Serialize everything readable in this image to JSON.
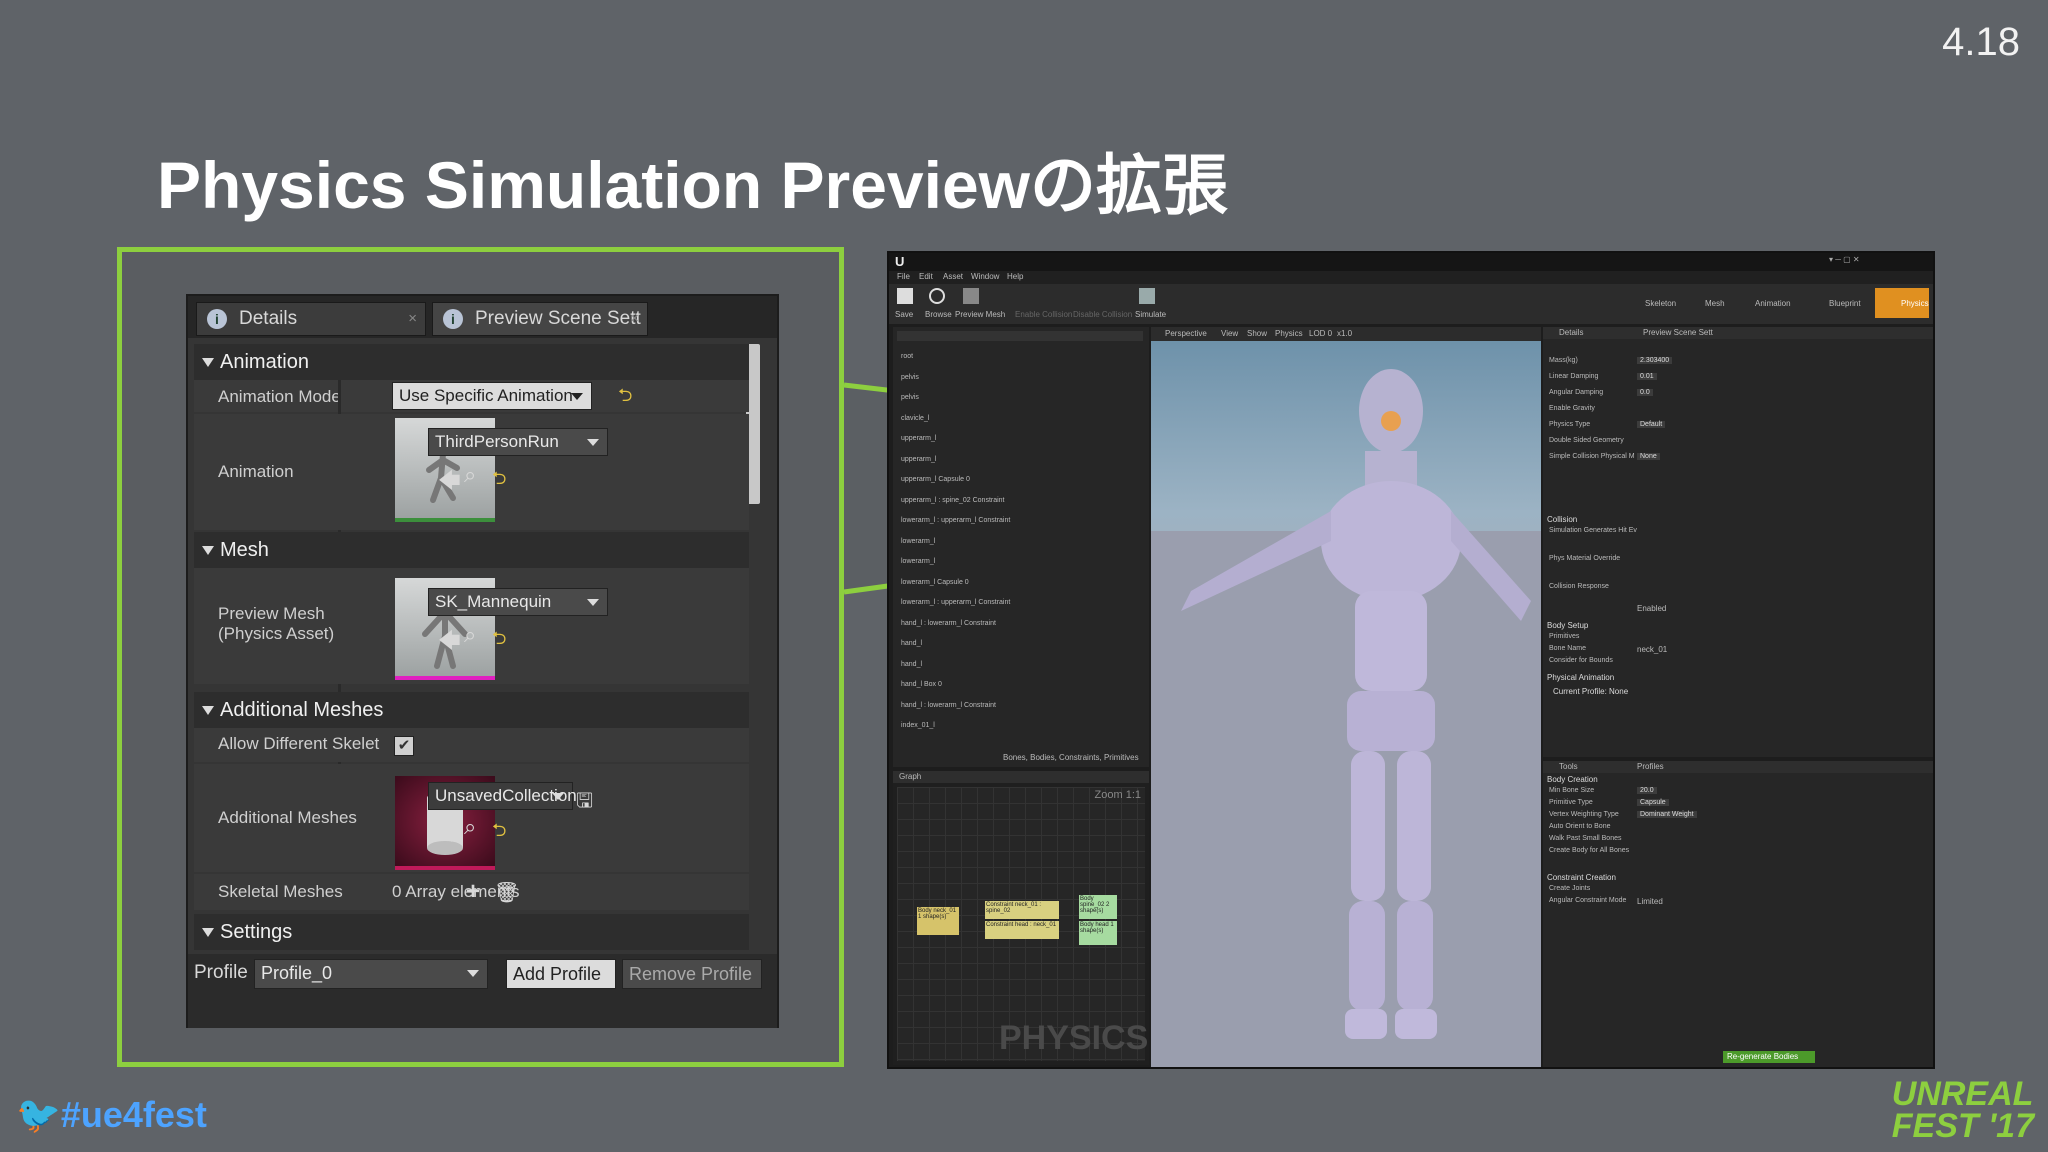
{
  "slide": {
    "version": "4.18",
    "title": "Physics Simulation Previewの拡張",
    "hashtag": "#ue4fest",
    "event_logo_line1": "UNREAL",
    "event_logo_line2": "FEST '17"
  },
  "details_panel": {
    "tabs": [
      {
        "label": "Details"
      },
      {
        "label": "Preview Scene Sett"
      }
    ],
    "sections": {
      "animation": {
        "header": "Animation",
        "animation_mode_label": "Animation Mode",
        "animation_mode_value": "Use Specific Animation",
        "animation_label": "Animation",
        "animation_value": "ThirdPersonRun"
      },
      "mesh": {
        "header": "Mesh",
        "preview_mesh_label_1": "Preview Mesh",
        "preview_mesh_label_2": "(Physics Asset)",
        "preview_mesh_value": "SK_Mannequin"
      },
      "additional_meshes": {
        "header": "Additional Meshes",
        "allow_different_label": "Allow Different Skelet",
        "allow_different_checked": true,
        "additional_meshes_label": "Additional Meshes",
        "additional_meshes_value": "UnsavedCollection",
        "skeletal_meshes_label": "Skeletal Meshes",
        "skeletal_meshes_value": "0 Array elements"
      },
      "settings": {
        "header": "Settings"
      }
    },
    "footer": {
      "profile_label": "Profile",
      "profile_value": "Profile_0",
      "add_profile": "Add Profile",
      "remove_profile": "Remove Profile"
    }
  },
  "editor_screenshot": {
    "menu": [
      "File",
      "Edit",
      "Asset",
      "Window",
      "Help"
    ],
    "toolbar": [
      "Save",
      "Browse",
      "Preview Mesh",
      "Enable Collision",
      "Disable Collision",
      "Simulate"
    ],
    "mode_buttons": [
      "Skeleton",
      "Mesh",
      "Animation",
      "Blueprint",
      "Physics"
    ],
    "viewport_buttons": [
      "Perspective",
      "View",
      "Show",
      "Physics",
      "LOD 0",
      "x1.0"
    ],
    "tree_items": [
      "root",
      "pelvis",
      "pelvis",
      "clavicle_l",
      "upperarm_l",
      "upperarm_l",
      "upperarm_l Capsule 0",
      "upperarm_l : spine_02 Constraint",
      "lowerarm_l : upperarm_l Constraint",
      "lowerarm_l",
      "lowerarm_l",
      "lowerarm_l Capsule 0",
      "lowerarm_l : upperarm_l Constraint",
      "hand_l : lowerarm_l Constraint",
      "hand_l",
      "hand_l",
      "hand_l Box 0",
      "hand_l : lowerarm_l Constraint",
      "index_01_l"
    ],
    "tree_filter": "Bones, Bodies, Constraints, Primitives",
    "graph_tab": "Graph",
    "graph_zoom": "Zoom 1:1",
    "graph_watermark": "PHYSICS",
    "graph_nodes": [
      "Body neck_01 1 shape(s)",
      "Constraint neck_01 : spine_02",
      "Constraint head : neck_01",
      "Body spine_02 2 shape(s)",
      "Body head 1 shape(s)"
    ],
    "right_tabs": [
      "Details",
      "Preview Scene Sett"
    ],
    "physics_props": [
      "Mass(kg)",
      "Linear Damping",
      "Angular Damping",
      "Enable Gravity",
      "Physics Type",
      "Double Sided Geometry",
      "Simple Collision Physical M"
    ],
    "physics_values": [
      "2.303400",
      "0.01",
      "0.0",
      "",
      "Default",
      "",
      "None"
    ],
    "collision_header": "Collision",
    "collision_props": [
      "Simulation Generates Hit Ev",
      "Phys Material Override",
      "Collision Response"
    ],
    "collision_response_value": "Enabled",
    "body_setup_header": "Body Setup",
    "body_setup_props": [
      "Primitives",
      "Bone Name",
      "Consider for Bounds"
    ],
    "bone_name_value": "neck_01",
    "physical_animation_header": "Physical Animation",
    "current_profile": "Current Profile: None",
    "tools_tabs": [
      "Tools",
      "Profiles"
    ],
    "body_creation_header": "Body Creation",
    "body_creation_props": [
      "Min Bone Size",
      "Primitive Type",
      "Vertex Weighting Type",
      "Auto Orient to Bone",
      "Walk Past Small Bones",
      "Create Body for All Bones"
    ],
    "body_creation_values": [
      "20.0",
      "Capsule",
      "Dominant Weight"
    ],
    "constraint_creation_header": "Constraint Creation",
    "constraint_props": [
      "Create Joints",
      "Angular Constraint Mode"
    ],
    "angular_mode_value": "Limited",
    "regenerate_button": "Re-generate Bodies"
  },
  "colors": {
    "accent_green": "#8dcf3f",
    "slide_bg": "#5f6368",
    "twitter_blue": "#4da3ff"
  }
}
